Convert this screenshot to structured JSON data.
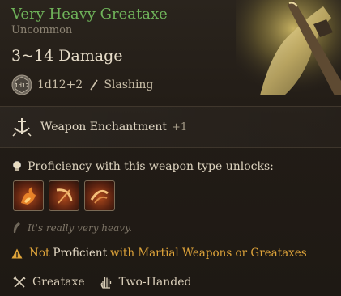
{
  "item": {
    "name": "Very Heavy Greataxe",
    "rarity": "Uncommon",
    "damage": "3~14 Damage",
    "dice_badge": "1d12",
    "dice": "1d12+2",
    "damage_type": "Slashing"
  },
  "enchantment": {
    "label": "Weapon Enchantment",
    "bonus": "+1"
  },
  "proficiency": {
    "label": "Proficiency with this weapon type unlocks:",
    "actions": [
      {
        "icon": "flame-cleave-icon"
      },
      {
        "icon": "sweeping-slash-icon"
      },
      {
        "icon": "lacerate-icon"
      }
    ]
  },
  "flavor": "It's really very heavy.",
  "warning": {
    "part1": "Not",
    "part2": "Proficient",
    "part3": "with Martial Weapons or Greataxes"
  },
  "tags": [
    {
      "label": "Greataxe",
      "icon": "crossed-axes-icon"
    },
    {
      "label": "Two-Handed",
      "icon": "hand-icon"
    }
  ],
  "colors": {
    "name": "#6fb35a",
    "warning": "#e0a53a",
    "background": "#221c16"
  }
}
